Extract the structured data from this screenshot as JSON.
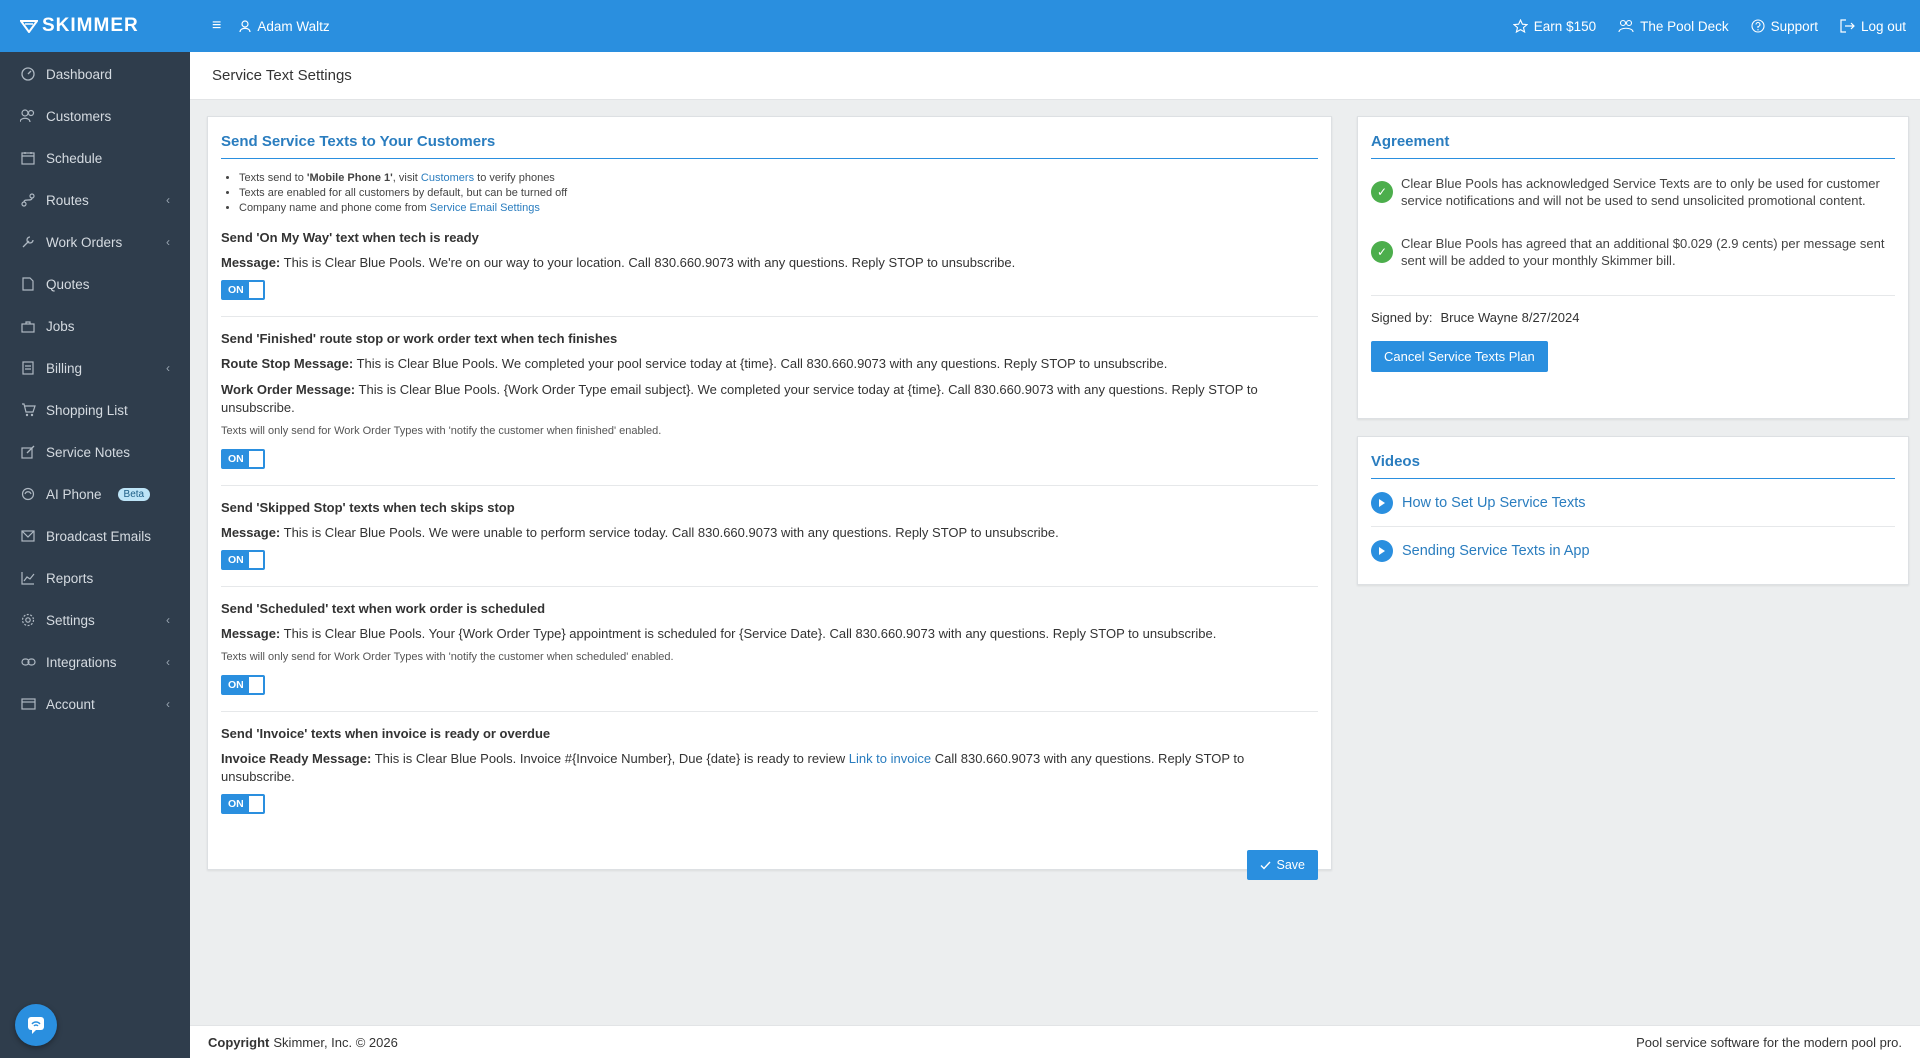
{
  "app": {
    "logo_text": "SKIMMER",
    "brand_color": "#2a8fdf",
    "sidebar_color": "#2f3d4c"
  },
  "sidebar": {
    "items": [
      {
        "label": "Dashboard",
        "icon": "gauge-icon",
        "has_submenu": false
      },
      {
        "label": "Customers",
        "icon": "users-icon",
        "has_submenu": false
      },
      {
        "label": "Schedule",
        "icon": "calendar-icon",
        "has_submenu": false
      },
      {
        "label": "Routes",
        "icon": "routes-icon",
        "has_submenu": true
      },
      {
        "label": "Work Orders",
        "icon": "wrench-icon",
        "has_submenu": true
      },
      {
        "label": "Quotes",
        "icon": "quote-doc-icon",
        "has_submenu": false
      },
      {
        "label": "Jobs",
        "icon": "briefcase-icon",
        "has_submenu": false
      },
      {
        "label": "Billing",
        "icon": "billing-icon",
        "has_submenu": true
      },
      {
        "label": "Shopping List",
        "icon": "cart-icon",
        "has_submenu": false
      },
      {
        "label": "Service Notes",
        "icon": "edit-icon",
        "has_submenu": false
      },
      {
        "label": "AI Phone",
        "icon": "phone-ai-icon",
        "has_submenu": false,
        "badge": "Beta"
      },
      {
        "label": "Broadcast Emails",
        "icon": "envelope-icon",
        "has_submenu": false
      },
      {
        "label": "Reports",
        "icon": "chart-line-icon",
        "has_submenu": false
      },
      {
        "label": "Settings",
        "icon": "gear-icon",
        "has_submenu": true
      },
      {
        "label": "Integrations",
        "icon": "link-icon",
        "has_submenu": true
      },
      {
        "label": "Account",
        "icon": "card-icon",
        "has_submenu": true
      }
    ]
  },
  "topbar": {
    "user_name": "Adam Waltz",
    "earn": "Earn $150",
    "pool_deck": "The Pool Deck",
    "support": "Support",
    "logout": "Log out"
  },
  "page": {
    "title": "Service Text Settings"
  },
  "main": {
    "title": "Send Service Texts to Your Customers",
    "notes": {
      "n1_pre": "Texts send to ",
      "n1_bold": "'Mobile Phone 1'",
      "n1_mid": ", visit ",
      "n1_link": "Customers",
      "n1_post": " to verify phones",
      "n2": "Texts are enabled for all customers by default, but can be turned off",
      "n3_pre": "Company name and phone come from ",
      "n3_link": "Service Email Settings"
    },
    "sections": {
      "omw": {
        "title": "Send 'On My Way' text when tech is ready",
        "label": "Message:",
        "text": "This is Clear Blue Pools. We're on our way to your location. Call 830.660.9073 with any questions. Reply STOP to unsubscribe.",
        "toggle": "ON"
      },
      "finished": {
        "title": "Send 'Finished' route stop or work order text when tech finishes",
        "route_label": "Route Stop Message:",
        "route_text": "This is Clear Blue Pools. We completed your pool service today at {time}. Call 830.660.9073 with any questions. Reply STOP to unsubscribe.",
        "wo_label": "Work Order Message:",
        "wo_text": "This is Clear Blue Pools. {Work Order Type email subject}. We completed your service today at {time}. Call 830.660.9073 with any questions. Reply STOP to unsubscribe.",
        "note": "Texts will only send for Work Order Types with 'notify the customer when finished' enabled.",
        "toggle": "ON"
      },
      "skipped": {
        "title": "Send 'Skipped Stop' texts when tech skips stop",
        "label": "Message:",
        "text": "This is Clear Blue Pools. We were unable to perform service today. Call 830.660.9073 with any questions. Reply STOP to unsubscribe.",
        "toggle": "ON"
      },
      "scheduled": {
        "title": "Send 'Scheduled' text when work order is scheduled",
        "label": "Message:",
        "text": "This is Clear Blue Pools. Your {Work Order Type} appointment is scheduled for {Service Date}. Call 830.660.9073 with any questions. Reply STOP to unsubscribe.",
        "note": "Texts will only send for Work Order Types with 'notify the customer when scheduled' enabled.",
        "toggle": "ON"
      },
      "invoice": {
        "title": "Send 'Invoice' texts when invoice is ready or overdue",
        "label": "Invoice Ready Message:",
        "text_pre": "This is Clear Blue Pools. Invoice #{Invoice Number}, Due {date} is ready to review",
        "link": "Link to invoice",
        "text_post": "Call 830.660.9073 with any questions. Reply STOP to unsubscribe.",
        "toggle": "ON"
      }
    },
    "save_label": "Save"
  },
  "agreement": {
    "title": "Agreement",
    "item1": "Clear Blue Pools has acknowledged Service Texts are to only be used for customer service notifications and will not be used to send unsolicited promotional content.",
    "item2": "Clear Blue Pools has agreed that an additional $0.029 (2.9 cents) per message sent sent will be added to your monthly Skimmer bill.",
    "signed_label": "Signed by:",
    "signed_value": "Bruce Wayne 8/27/2024",
    "cancel_label": "Cancel Service Texts Plan"
  },
  "videos": {
    "title": "Videos",
    "items": [
      "How to Set Up Service Texts",
      "Sending Service Texts in App"
    ]
  },
  "footer": {
    "copyright_label": "Copyright",
    "copyright_text": "Skimmer, Inc. © 2026",
    "tagline": "Pool service software for the modern pool pro."
  }
}
